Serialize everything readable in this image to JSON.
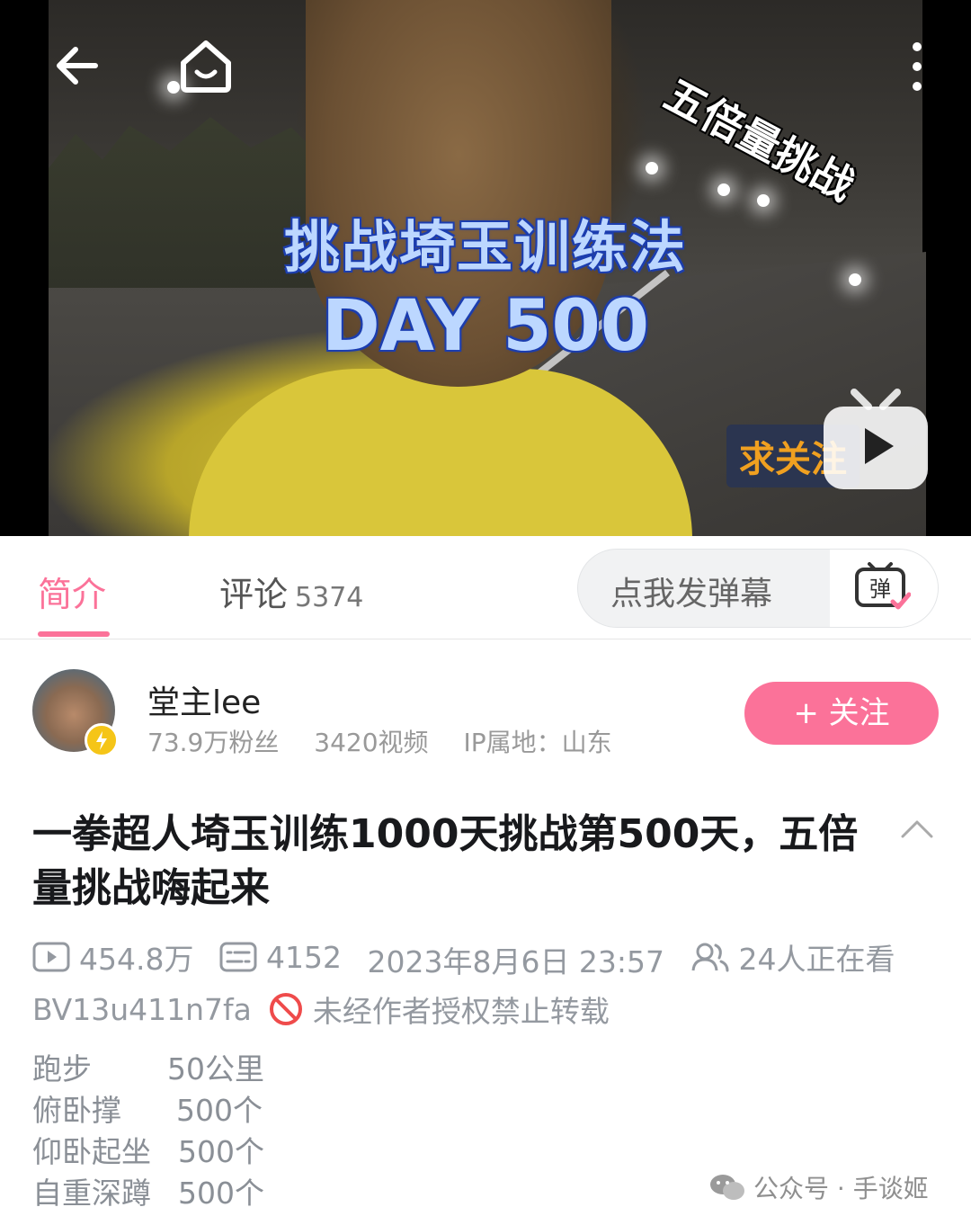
{
  "video": {
    "overlay_title_line1": "挑战埼玉训练法",
    "overlay_title_line2": "DAY 500",
    "overlay_corner_text": "五倍量挑战",
    "overlay_follow_tag": "求关注"
  },
  "tabs": {
    "intro_label": "简介",
    "comments_label": "评论",
    "comments_count": "5374"
  },
  "danmaku": {
    "placeholder": "点我发弹幕",
    "button_icon": "danmaku-icon"
  },
  "uploader": {
    "name": "堂主lee",
    "fans": "73.9万粉丝",
    "videos": "3420视频",
    "ip_location": "IP属地：山东",
    "follow_label": "+ 关注"
  },
  "video_info": {
    "title": "一拳超人埼玉训练1000天挑战第500天，五倍量挑战嗨起来",
    "play_count": "454.8万",
    "danmaku_count": "4152",
    "publish_time": "2023年8月6日 23:57",
    "watching_now": "24人正在看",
    "bvid": "BV13u411n7fa",
    "copyright_notice": "未经作者授权禁止转载"
  },
  "description": [
    {
      "item": "跑步",
      "amount": "50公里"
    },
    {
      "item": "俯卧撑",
      "amount": "500个"
    },
    {
      "item": "仰卧起坐",
      "amount": "500个"
    },
    {
      "item": "自重深蹲",
      "amount": "500个"
    }
  ],
  "watermark": "公众号 · 手谈姬",
  "colors": {
    "accent_pink": "#fb7299",
    "meta_gray": "#9499a0",
    "title_text": "#18191c"
  }
}
